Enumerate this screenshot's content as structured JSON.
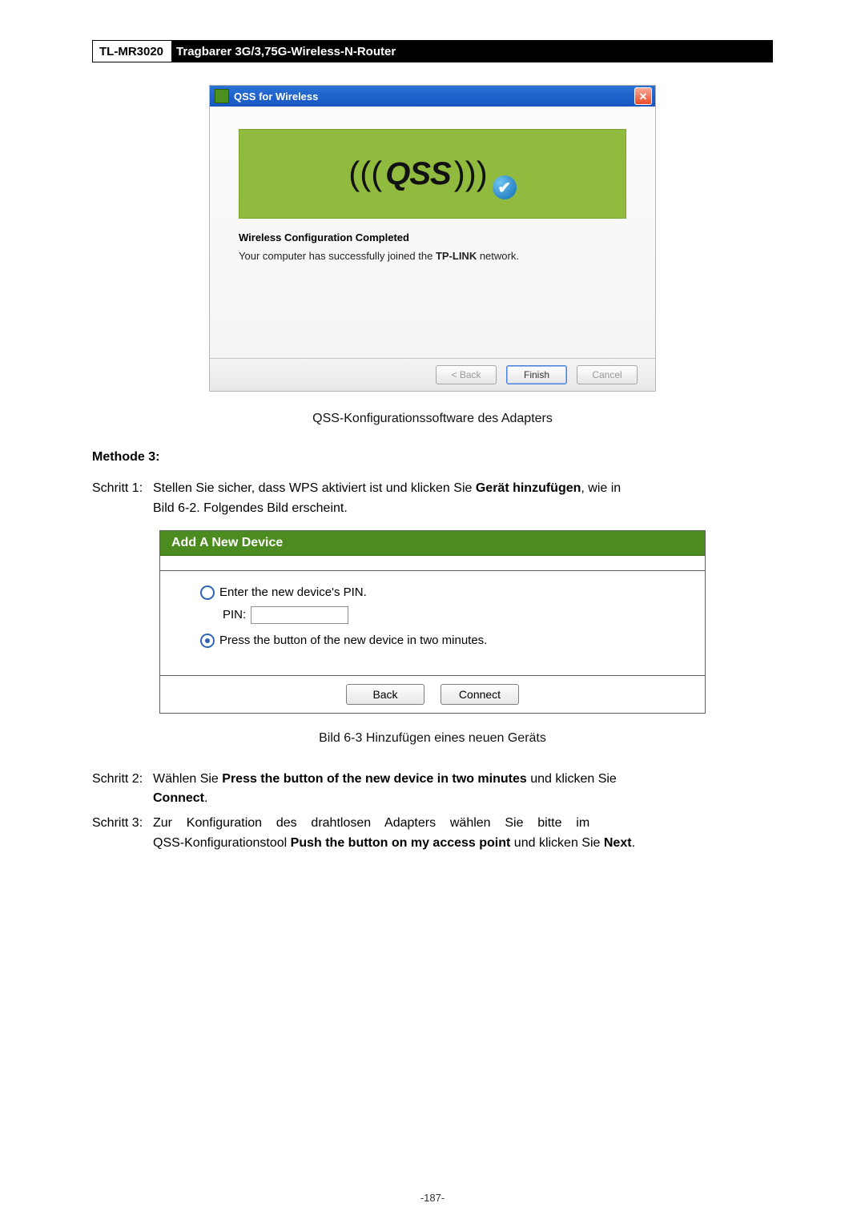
{
  "header": {
    "model": "TL-MR3020",
    "title": "Tragbarer 3G/3,75G-Wireless-N-Router"
  },
  "qss": {
    "window_title": "QSS for Wireless",
    "logo_text": "QSS",
    "heading": "Wireless Configuration Completed",
    "line_pre": "Your computer has successfully joined the ",
    "line_bold": "TP-LINK",
    "line_post": " network.",
    "btn_back": "< Back",
    "btn_finish": "Finish",
    "btn_cancel": "Cancel"
  },
  "caption1": "QSS-Konfigurationssoftware des Adapters",
  "method_heading": "Methode 3:",
  "step1": {
    "label": "Schritt 1:",
    "text_pre": "Stellen Sie sicher, dass WPS aktiviert ist und klicken Sie ",
    "text_bold": "Gerät hinzufügen",
    "text_post": ", wie in",
    "line2": "Bild 6-2. Folgendes Bild erscheint."
  },
  "addpanel": {
    "title": "Add A New Device",
    "opt1": "Enter the new device's PIN.",
    "pin_label": "PIN:",
    "opt2": "Press the button of the new device in two minutes.",
    "btn_back": "Back",
    "btn_connect": "Connect"
  },
  "caption2": "Bild 6-3 Hinzufügen eines neuen Geräts",
  "step2": {
    "label": "Schritt 2:",
    "text_pre": "Wählen Sie ",
    "text_bold": "Press the button of the new device in two minutes",
    "text_mid": " und klicken Sie",
    "line2_bold": "Connect",
    "line2_post": "."
  },
  "step3": {
    "label": "Schritt 3:",
    "line1": "Zur    Konfiguration    des    drahtlosen    Adapters    wählen    Sie    bitte    im",
    "line2_pre": "QSS-Konfigurationstool ",
    "line2_bold": "Push the button on my access point",
    "line2_mid": " und klicken Sie ",
    "line2_bold2": "Next",
    "line2_post": "."
  },
  "page_number": "-187-"
}
